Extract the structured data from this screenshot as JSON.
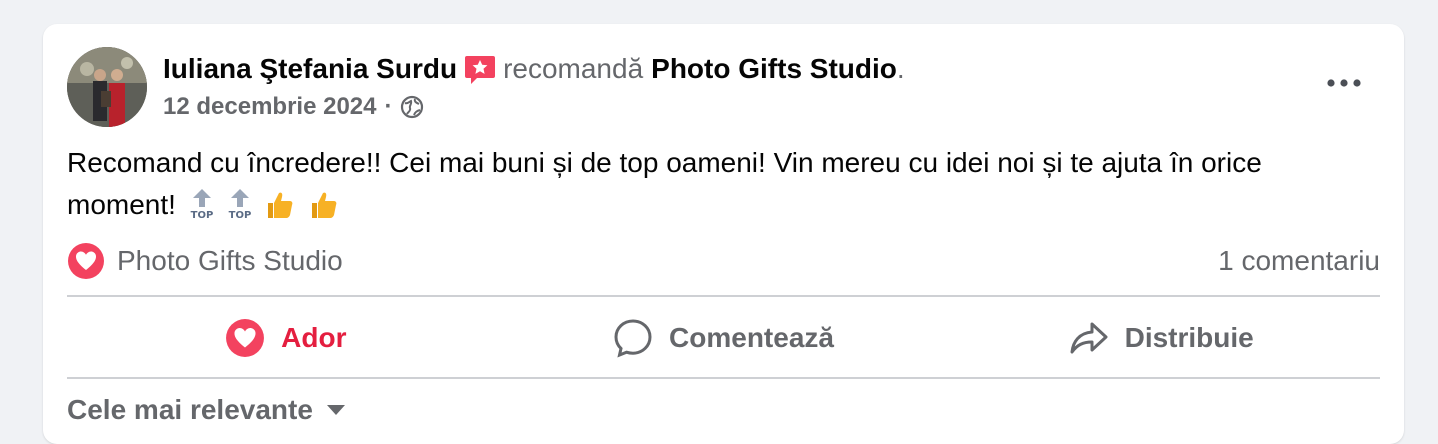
{
  "post": {
    "author": "Iuliana Ştefania Surdu",
    "recommends_text": "recomandă",
    "page_name": "Photo Gifts Studio",
    "trailing_period": ".",
    "date": "12 decembrie 2024",
    "meta_separator": "·",
    "audience_icon": "globe-icon",
    "text": "Recomand cu încredere!! Cei mai buni și de top oameni! Vin mereu cu idei noi și te ajuta în orice moment!",
    "emojis": [
      "top-arrow",
      "top-arrow",
      "thumbs-up",
      "thumbs-up"
    ]
  },
  "stats": {
    "reaction_icon": "heart-icon",
    "reacted_by": "Photo Gifts Studio",
    "comments": "1 comentariu"
  },
  "actions": {
    "love_label": "Ador",
    "comment_label": "Comentează",
    "share_label": "Distribuie"
  },
  "comments": {
    "sort_label": "Cele mai relevante"
  },
  "colors": {
    "background": "#f0f2f5",
    "card": "#ffffff",
    "secondary_text": "#65676b",
    "love_red": "#e41e3f",
    "recommend_badge": "#f3425f",
    "thumbs_yellow": "#f7b125"
  }
}
